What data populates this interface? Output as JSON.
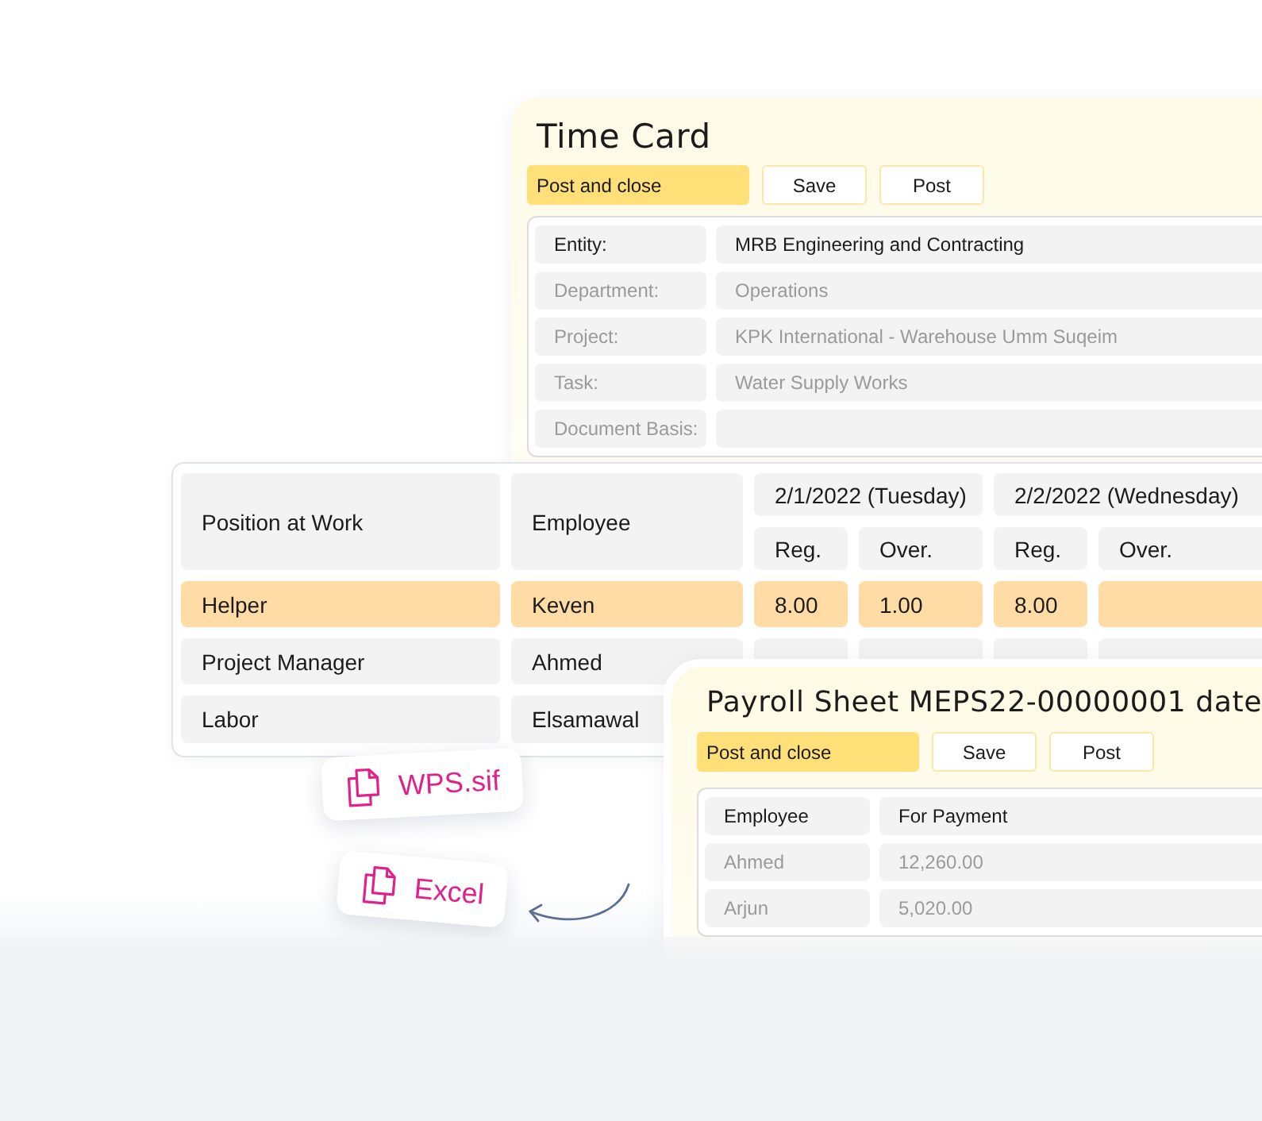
{
  "time_card": {
    "title": "Time Card",
    "buttons": [
      {
        "label": "Post and close",
        "kind": "primary"
      },
      {
        "label": "Save",
        "kind": "secondary"
      },
      {
        "label": "Post",
        "kind": "secondary"
      }
    ],
    "fields": [
      {
        "label": "Entity:",
        "value": "MRB Engineering and Contracting",
        "disabled": false
      },
      {
        "label": "Department:",
        "value": "Operations",
        "disabled": true
      },
      {
        "label": "Project:",
        "value": "KPK International - Warehouse Umm Suqeim",
        "disabled": true
      },
      {
        "label": "Task:",
        "value": "Water Supply Works",
        "disabled": true
      },
      {
        "label": "Document Basis:",
        "disabled": true
      }
    ]
  },
  "timesheet": {
    "columns": [
      "Position at Work",
      "Employee"
    ],
    "days": [
      {
        "date": "2/1/2022 (Tuesday)",
        "subcolumns": [
          "Reg.",
          "Over."
        ]
      },
      {
        "date": "2/2/2022 (Wednesday)",
        "subcolumns": [
          "Reg.",
          "Over."
        ]
      }
    ],
    "rows": [
      {
        "position": "Helper",
        "employee": "Keven",
        "hours": [
          "8.00",
          "1.00",
          "8.00"
        ],
        "selected": true
      },
      {
        "position": "Project Manager",
        "employee": "Ahmed",
        "selected": false
      },
      {
        "position": "Labor",
        "employee": "Elsamawal",
        "selected": false
      }
    ]
  },
  "exports": [
    {
      "label": "WPS.sif"
    },
    {
      "label": "Excel"
    }
  ],
  "payroll_sheet": {
    "title": "Payroll Sheet MEPS22-00000001 date",
    "buttons": [
      {
        "label": "Post and close",
        "kind": "primary"
      },
      {
        "label": "Save",
        "kind": "secondary"
      },
      {
        "label": "Post",
        "kind": "secondary"
      }
    ],
    "columns": [
      "Employee",
      "For Payment"
    ],
    "rows": [
      {
        "employee": "Ahmed",
        "amount": "12,260.00",
        "disabled": true
      },
      {
        "employee": "Arjun",
        "amount": "5,020.00",
        "disabled": true
      }
    ]
  }
}
